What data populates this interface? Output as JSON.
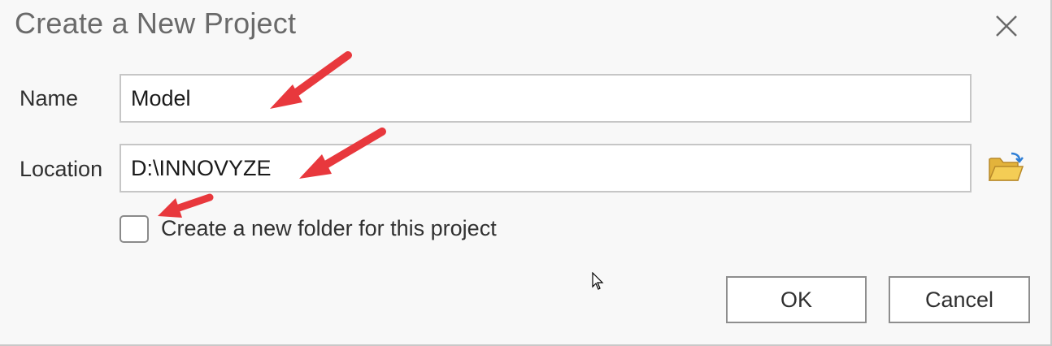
{
  "dialog": {
    "title": "Create a New Project",
    "close_icon": "close-icon"
  },
  "form": {
    "name_label": "Name",
    "name_value": "Model",
    "location_label": "Location",
    "location_value": "D:\\INNOVYZE",
    "browse_icon": "folder-open-icon",
    "checkbox_label": "Create a new folder for this project",
    "checkbox_checked": false
  },
  "buttons": {
    "ok_label": "OK",
    "cancel_label": "Cancel"
  },
  "annotations": {
    "arrow_color": "#e8383d",
    "arrow_count": 3
  }
}
